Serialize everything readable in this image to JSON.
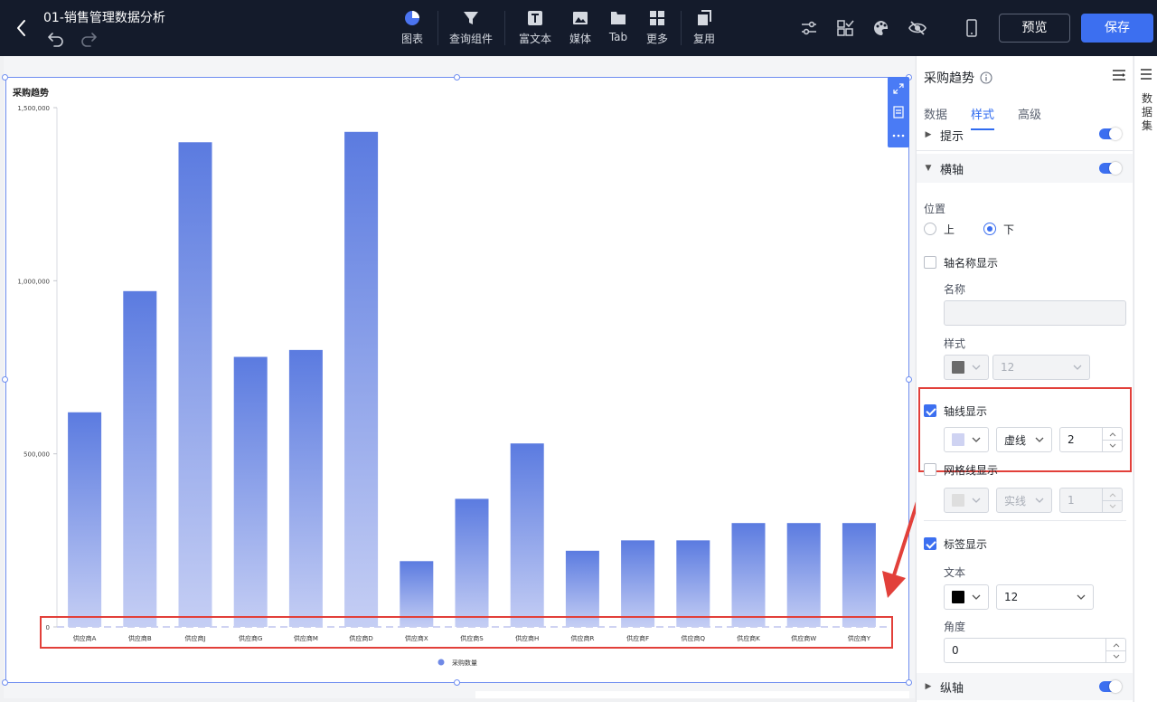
{
  "header": {
    "doc_title": "01-销售管理数据分析",
    "tools": [
      {
        "label": "图表",
        "icon": "chart-icon"
      },
      {
        "label": "查询组件",
        "icon": "filter-icon"
      },
      {
        "label": "富文本",
        "icon": "text-icon"
      },
      {
        "label": "媒体",
        "icon": "image-icon"
      },
      {
        "label": "Tab",
        "icon": "tab-icon"
      },
      {
        "label": "更多",
        "icon": "grid-icon"
      },
      {
        "label": "复用",
        "icon": "copy-icon"
      }
    ],
    "preview_label": "预览",
    "save_label": "保存",
    "accent": "#3c6ff0"
  },
  "chart_data": {
    "type": "bar",
    "title": "采购趋势",
    "categories": [
      "供应商A",
      "供应商B",
      "供应商J",
      "供应商G",
      "供应商M",
      "供应商D",
      "供应商X",
      "供应商S",
      "供应商H",
      "供应商R",
      "供应商F",
      "供应商Q",
      "供应商K",
      "供应商W",
      "供应商Y"
    ],
    "series": [
      {
        "name": "采购数量",
        "values": [
          620000,
          970000,
          1400000,
          780000,
          800000,
          1430000,
          190000,
          370000,
          530000,
          220000,
          250000,
          250000,
          300000,
          300000,
          300000
        ]
      }
    ],
    "yticks": [
      "0",
      "500,000",
      "1,000,000",
      "1,500,000"
    ],
    "ylim": [
      0,
      1500000
    ],
    "bar_color_top": "#5b7be0",
    "bar_color_bottom": "#c5cef4",
    "x_axis_line": "dashed",
    "legend_position": "bottom"
  },
  "panel": {
    "title": "采购趋势",
    "menu_label": "",
    "tabs": [
      "数据",
      "样式",
      "高级"
    ],
    "active_tab": "样式",
    "tooltip_section": "提示",
    "x_axis_section": "横轴",
    "position_label": "位置",
    "position_top": "上",
    "position_bottom": "下",
    "axis_name_label": "轴名称显示",
    "name_label": "名称",
    "name_value": "",
    "style_label": "样式",
    "style_font_size": "12",
    "axis_line_label": "轴线显示",
    "axis_line_type": "虚线",
    "axis_line_width": "2",
    "axis_line_color": "#cfd3f2",
    "grid_label": "网格线显示",
    "grid_line_type": "实线",
    "grid_line_width": "1",
    "tick_label": "标签显示",
    "text_label": "文本",
    "text_size": "12",
    "text_color": "#000000",
    "angle_label": "角度",
    "angle_value": "0",
    "y_axis_section": "纵轴"
  },
  "side_tab": "数据集"
}
